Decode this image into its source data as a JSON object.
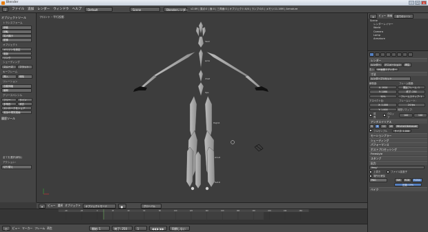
{
  "window": {
    "title": "Blender"
  },
  "menubar": {
    "items": [
      "ファイル",
      "追加",
      "レンダー",
      "ウィンドウ",
      "ヘルプ"
    ],
    "layout": "Default",
    "scene": "Scene",
    "engine": "Blenderレンダー",
    "stats": "v2.69 | 頂点:0 | 面:0 | 三角面:0 | オブジェクト:0/4 | ランプ:0/1 | メモリ:11.16M | Armature"
  },
  "left": {
    "title": "オブジェクトツール",
    "sections": [
      {
        "sub": "トランスフォーム",
        "buttons": [
          "移動",
          "回転",
          "拡大縮小",
          "鏡像"
        ]
      },
      {
        "sub": "オブジェクト",
        "buttons": [
          "オリジンを設定",
          "複製",
          "リンク"
        ]
      },
      {
        "sub": "シェーディング",
        "pairs": [
          [
            "スムーズ",
            "フラット"
          ]
        ]
      },
      {
        "sub": "キーフレーム",
        "pairs": [
          [
            "挿入",
            "削除"
          ]
        ]
      },
      {
        "sub": "リレーション",
        "buttons": [
          "自動伸縮",
          "緩和"
        ]
      },
      {
        "sub": "グリースペンシル",
        "pairs": [
          [
            "フリー",
            "ライン"
          ],
          [
            "多角形",
            "消去"
          ]
        ],
        "buttons": [
          "ストロークをシェア",
          "追加の視覚描画"
        ]
      }
    ],
    "history": "履歴ツール",
    "operator": "全てを選択(解除)",
    "action_label": "アクション:",
    "action_value": "切り替え"
  },
  "viewport": {
    "label": "フロント・平行投影"
  },
  "header3d": {
    "items": [
      "ビュー",
      "選択",
      "オブジェクト"
    ],
    "mode": "オブジェクトモード",
    "global": "グローバル"
  },
  "timeline": {
    "ticks": [
      "-40",
      "-20",
      "0",
      "20",
      "40",
      "60",
      "80",
      "100",
      "120",
      "140",
      "160",
      "180",
      "200",
      "220",
      "240",
      "260"
    ],
    "header": [
      "ビュー",
      "マーカー",
      "フレーム",
      "再生"
    ],
    "start": "開始: 1",
    "end": "終了: 250",
    "current": "1",
    "sync": "同期しない"
  },
  "outliner": {
    "header": [
      "ビュー",
      "検索",
      "全てのシーン"
    ],
    "tree": [
      "Scene",
      "レンダーレイヤー",
      "World",
      "Camera",
      "Lamp",
      "Armature"
    ]
  },
  "properties": {
    "render_title": "レンダー",
    "render_buttons": [
      "レンダー",
      "アニメーション",
      "再生"
    ],
    "display": "表示:",
    "display_value": "UV画像エディター",
    "presets_label": "寸法",
    "presets": "レンダープリセット",
    "resolution": "解像度:",
    "frame_range": "フレーム範囲:",
    "res_x": "X: 1920",
    "res_y": "Y: 1080",
    "percent": "50%",
    "start": "開始フレーム: 1",
    "end": "終了: 250",
    "step": "フレームステップ: 1",
    "aspect": "アスペクト比:",
    "aspect_x": "X: 1.000",
    "aspect_y": "Y: 1.000",
    "framerate": "フレームレート:",
    "fps": "24 fps",
    "border": "境界",
    "crop": "クロップ",
    "timemap": "時間リマップ:",
    "old": "100",
    "new": "100",
    "aa": "アンチエイリアス",
    "aa_vals": [
      "5",
      "8",
      "11",
      "16"
    ],
    "filter": "Mitchell-Netravali",
    "full_sample": "フルサンプル",
    "size": "サイズ: 1.000",
    "sections": [
      "モーションブラー",
      "シェーディング",
      "パフォーマンス",
      "ポストプロセッシング",
      "Freestyle",
      "スタンプ"
    ],
    "output": "出力",
    "path": "/tmp/",
    "overwrite": "上書き",
    "ext": "ファイル拡張子",
    "placeholders": "場所を確保",
    "format": "PNG",
    "bw": "BW",
    "rgb": "RGB",
    "rgba": "RGBA",
    "compression": "圧縮: 15%",
    "bake": "ベイク"
  }
}
